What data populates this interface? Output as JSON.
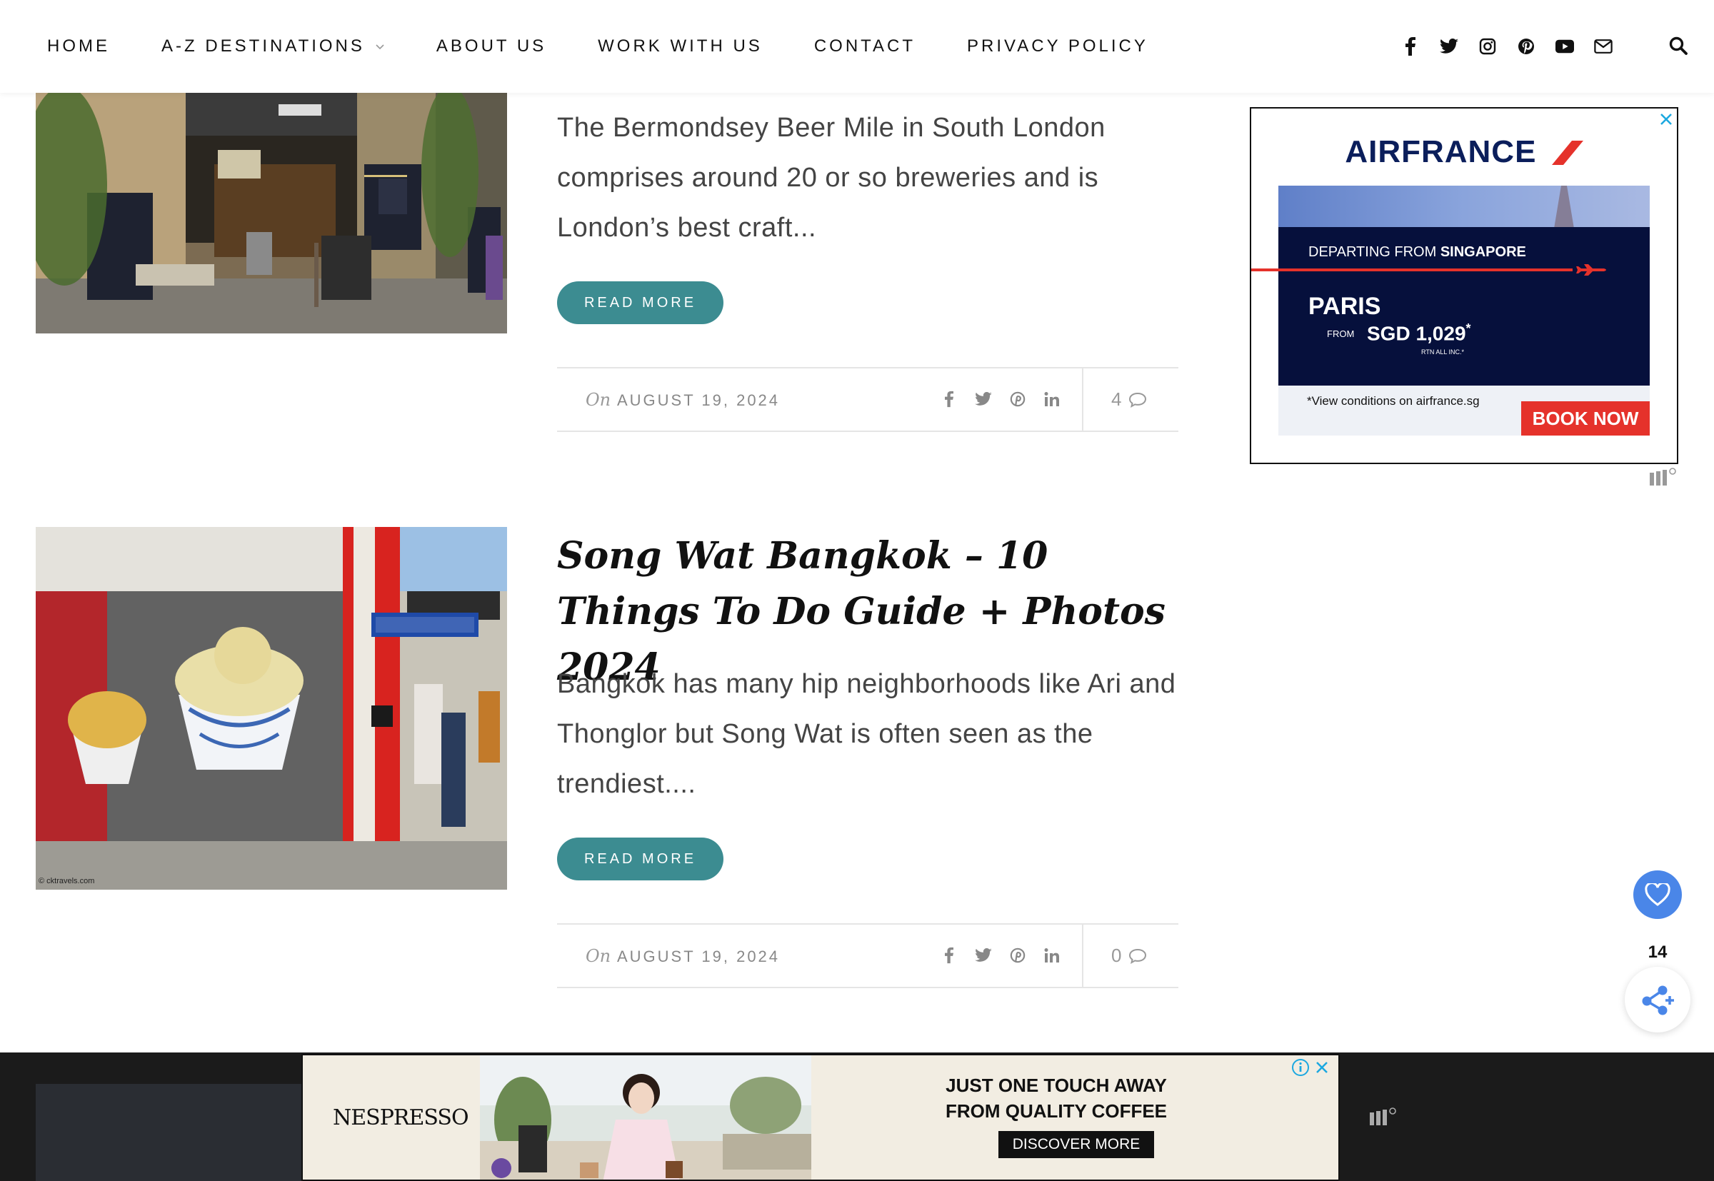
{
  "nav": {
    "items": [
      {
        "label": "HOME"
      },
      {
        "label": "A-Z DESTINATIONS",
        "has_dropdown": true
      },
      {
        "label": "ABOUT US"
      },
      {
        "label": "WORK WITH US"
      },
      {
        "label": "CONTACT"
      },
      {
        "label": "PRIVACY POLICY"
      }
    ],
    "social_icons": [
      "facebook-icon",
      "twitter-icon",
      "instagram-icon",
      "pinterest-icon",
      "youtube-icon",
      "envelope-icon"
    ],
    "search_icon": "search-icon"
  },
  "posts": [
    {
      "title": "",
      "excerpt": "The Bermondsey Beer Mile in South London comprises around 20 or so breweries and is London’s best craft...",
      "read_more": "READ MORE",
      "date_prefix": "On",
      "date": "AUGUST 19, 2024",
      "comment_count": "4"
    },
    {
      "title": "Song Wat Bangkok – 10 Things To Do Guide + Photos 2024",
      "excerpt": "Bangkok has many hip neighborhoods like Ari and Thonglor but Song Wat is often seen as the trendiest....",
      "read_more": "READ MORE",
      "date_prefix": "On",
      "date": "AUGUST 19, 2024",
      "comment_count": "0",
      "image_watermark": "© cktravels.com"
    }
  ],
  "share_icons": [
    "facebook-icon",
    "twitter-icon",
    "pinterest-icon",
    "linkedin-icon"
  ],
  "sidebar_ad": {
    "logo": "AIRFRANCE",
    "departing_prefix": "DEPARTING FROM",
    "departing_city": "SINGAPORE",
    "destination": "PARIS",
    "from_label": "FROM",
    "price": "SGD 1,029",
    "price_mark": "*",
    "price_note": "RTN ALL INC.*",
    "conditions": "*View conditions on airfrance.sg",
    "cta": "BOOK NOW"
  },
  "floating": {
    "share_count": "14"
  },
  "bottom_ad": {
    "brand": "NESPRESSO",
    "headline_line1": "JUST ONE TOUCH AWAY",
    "headline_line2": "FROM QUALITY COFFEE",
    "cta": "DISCOVER MORE"
  },
  "colors": {
    "accent": "#3c8c91",
    "airfrance_navy": "#06103c",
    "airfrance_red": "#e5322b",
    "float_blue": "#4a86e8"
  }
}
